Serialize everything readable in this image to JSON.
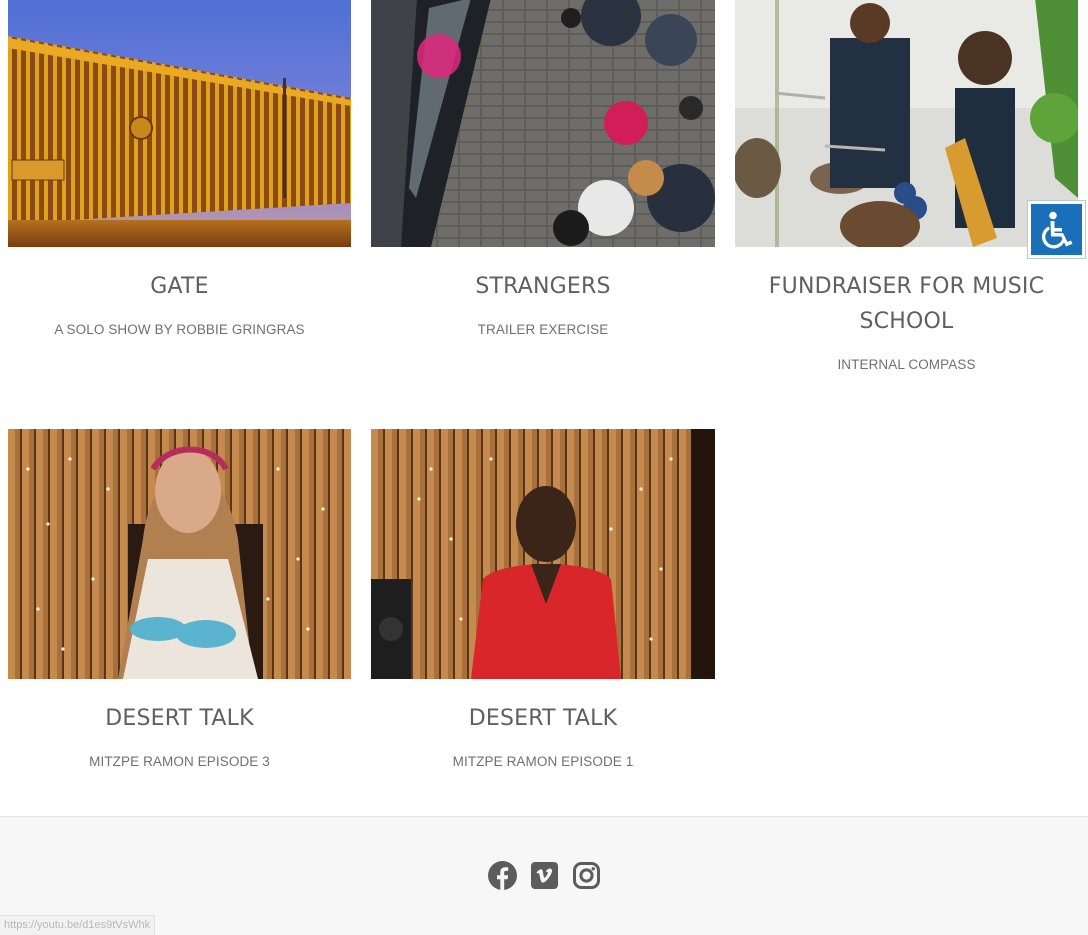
{
  "projects": [
    {
      "title": "GATE",
      "subtitle": "A SOLO SHOW BY ROBBIE GRINGRAS",
      "thumbnail": "gate-fence-sunset-photo"
    },
    {
      "title": "STRANGERS",
      "subtitle": "TRAILER EXERCISE",
      "thumbnail": "crowd-from-above-photo"
    },
    {
      "title": "FUNDRAISER FOR MUSIC SCHOOL",
      "subtitle": "INTERNAL COMPASS",
      "thumbnail": "band-performing-photo"
    },
    {
      "title": "DESERT TALK",
      "subtitle": "MITZPE RAMON EPISODE 3",
      "thumbnail": "girl-interview-photo"
    },
    {
      "title": "DESERT TALK",
      "subtitle": "MITZPE RAMON EPISODE 1",
      "thumbnail": "woman-interview-photo"
    }
  ],
  "footer": {
    "social_icons": [
      "facebook-icon",
      "vimeo-icon",
      "instagram-icon"
    ],
    "icon_color": "#5c5c5c"
  },
  "status_bar": {
    "url": "https://youtu.be/d1es9tVsWhk"
  },
  "accessibility_button": {
    "icon": "wheelchair-icon",
    "color": "#1a6fb9"
  }
}
